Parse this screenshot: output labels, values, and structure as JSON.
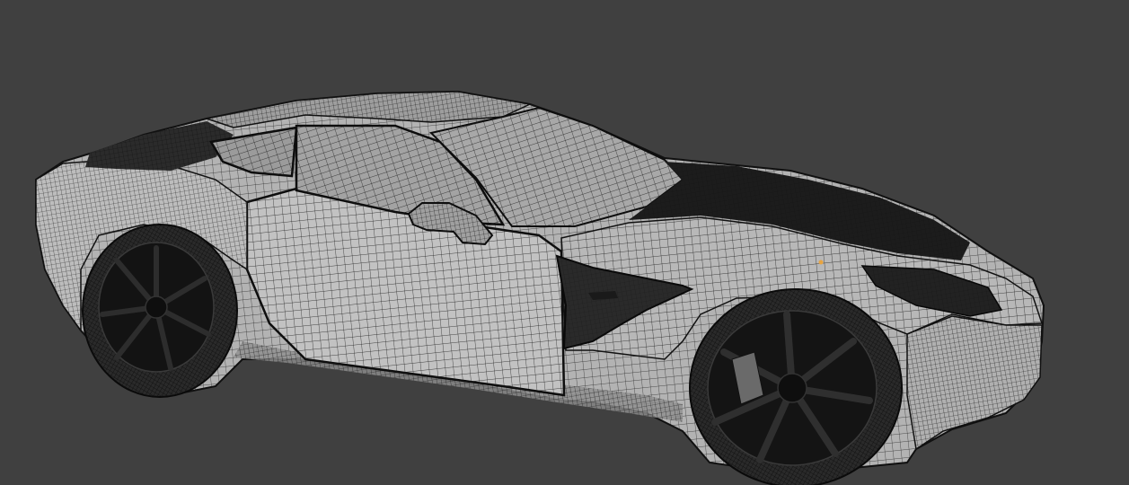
{
  "viewport": {
    "background_color": "#404040",
    "mode": "wireframe-overlay-on-solid",
    "object": "sports-car-mesh"
  },
  "colors": {
    "body_surface": "#b9b9b9",
    "body_shadow": "#8d8d8d",
    "wire": "#141414",
    "glass": "#9a9a9a",
    "dark_parts": "#1a1a1a",
    "tire": "#222222",
    "rim": "#111111",
    "selected_vertex": "#e8a440"
  }
}
